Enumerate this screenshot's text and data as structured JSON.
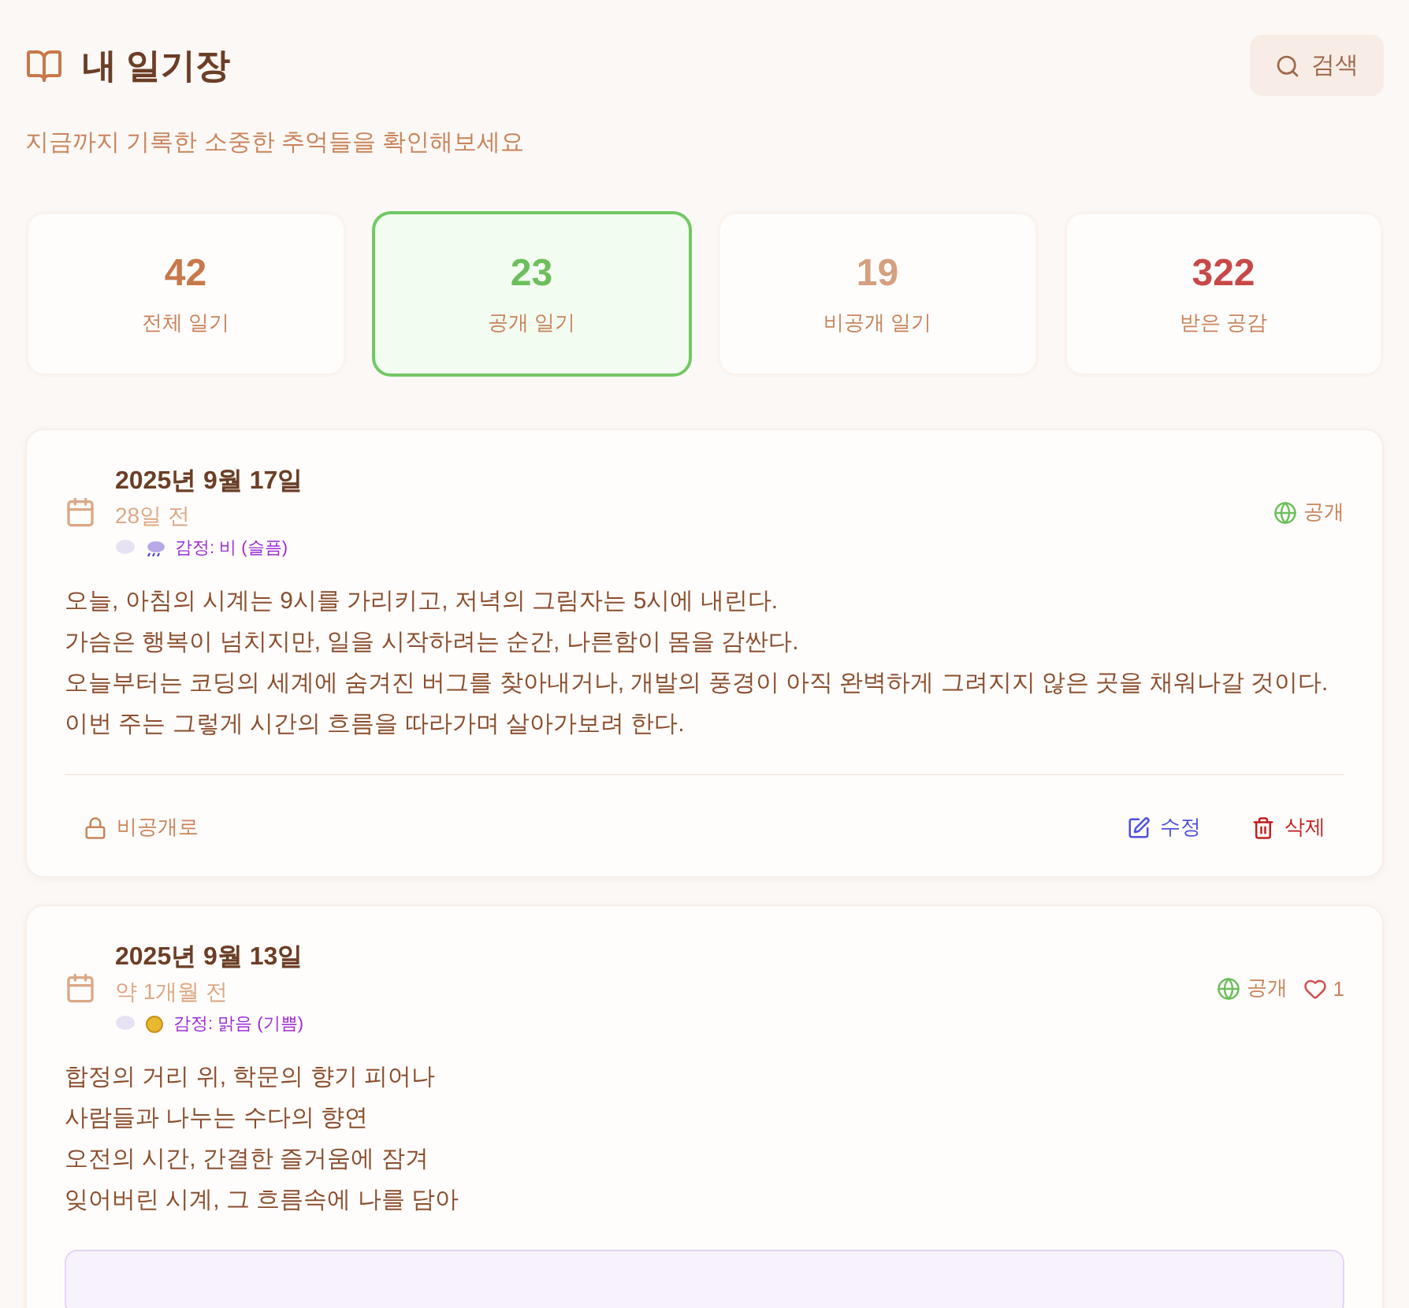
{
  "header": {
    "title": "내 일기장",
    "subtitle": "지금까지 기록한 소중한 추억들을 확인해보세요",
    "search_button": "검색"
  },
  "stats": [
    {
      "value": "42",
      "label": "전체 일기",
      "selected": false,
      "color": "#c8784a"
    },
    {
      "value": "23",
      "label": "공개 일기",
      "selected": true,
      "color": "#6cbf5c"
    },
    {
      "value": "19",
      "label": "비공개 일기",
      "selected": false,
      "color": "#d4a080"
    },
    {
      "value": "322",
      "label": "받은 공감",
      "selected": false,
      "color": "#c84848"
    }
  ],
  "entries": [
    {
      "date": "2025년 9월 17일",
      "relative": "28일 전",
      "kind": "rain",
      "emotion": "감정: 비 (슬픔)",
      "visibility": "공개",
      "public": true,
      "content": [
        "오늘, 아침의 시계는 9시를 가리키고, 저녁의 그림자는 5시에 내린다.",
        "가슴은 행복이 넘치지만, 일을 시작하려는 순간, 나른함이 몸을 감싼다.",
        "오늘부터는 코딩의 세계에 숨겨진 버그를 찾아내거나, 개발의 풍경이 아직 완벽하게 그려지지 않은 곳을 채워나갈 것이다.",
        "이번 주는 그렇게 시간의 흐름을 따라가며 살아가보려 한다."
      ],
      "actions": {
        "toggle": "비공개로",
        "edit": "수정",
        "delete": "삭제"
      }
    },
    {
      "date": "2025년 9월 13일",
      "relative": "약 1개월 전",
      "kind": "sun",
      "emotion": "감정: 맑음 (기쁨)",
      "visibility": "공개",
      "public": true,
      "likes": "1",
      "content": [
        "합정의 거리 위, 학문의 향기 피어나",
        "사람들과 나누는 수다의 향연",
        "오전의 시간, 간결한 즐거움에 잠겨",
        "잊어버린 시계, 그 흐름속에 나를 담아"
      ],
      "note_box": true
    }
  ]
}
